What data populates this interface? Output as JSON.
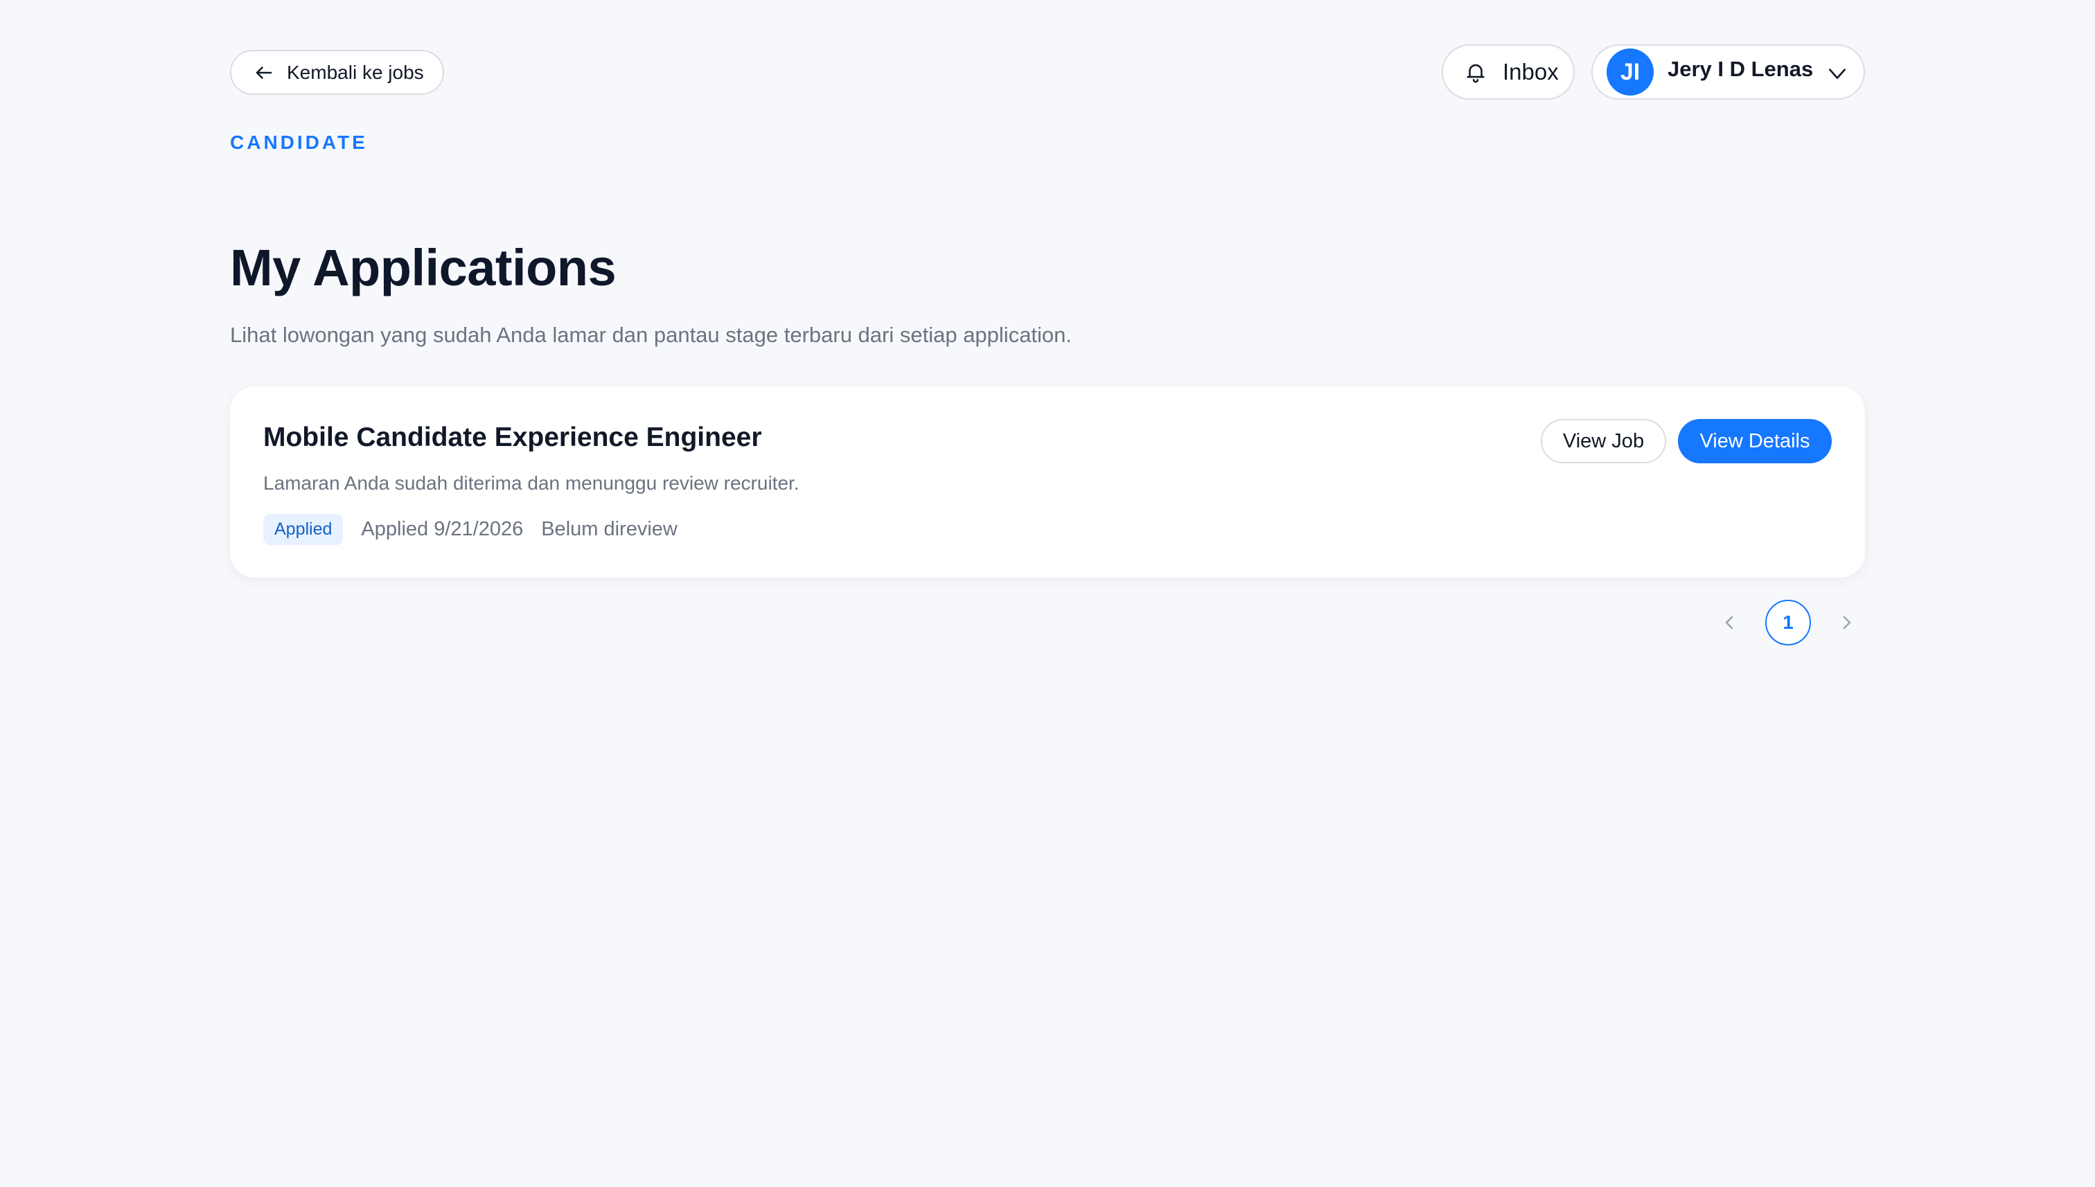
{
  "header": {
    "back_label": "Kembali ke jobs",
    "eyebrow": "CANDIDATE",
    "inbox_label": "Inbox",
    "user": {
      "initials": "JI",
      "name": "Jery I D Lenas"
    }
  },
  "main": {
    "title": "My Applications",
    "subtitle": "Lihat lowongan yang sudah Anda lamar dan pantau stage terbaru dari setiap application.",
    "applications": [
      {
        "title": "Mobile Candidate Experience Engineer",
        "description": "Lamaran Anda sudah diterima dan menunggu review recruiter.",
        "status": "Applied",
        "applied_date": "Applied 9/21/2026",
        "review_status": "Belum direview",
        "view_job_label": "View Job",
        "view_details_label": "View Details"
      }
    ]
  },
  "pagination": {
    "current_page": "1"
  },
  "colors": {
    "accent": "#1677ff",
    "background": "#f7f8fb",
    "badge_bg": "#e7f1ff"
  },
  "icons": {
    "back": "arrow-left-icon",
    "inbox": "bell-icon",
    "user_menu": "chevron-down-icon",
    "prev": "chevron-left-icon",
    "next": "chevron-right-icon"
  }
}
